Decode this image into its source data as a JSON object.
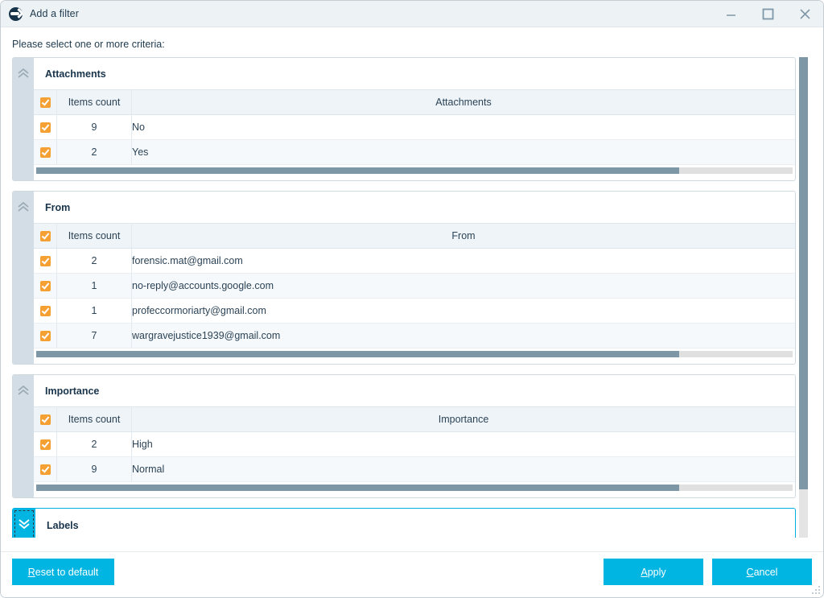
{
  "window": {
    "title": "Add a filter",
    "icon": "app-logo-icon",
    "controls": {
      "minimize": "minimize-icon",
      "maximize": "maximize-icon",
      "close": "close-icon"
    }
  },
  "prompt": "Please select one or more criteria:",
  "columns": {
    "count": "Items count"
  },
  "sections": [
    {
      "title": "Attachments",
      "collapsed": false,
      "value_header": "Attachments",
      "header_checked": true,
      "hscroll_percent": 85,
      "rows": [
        {
          "checked": true,
          "count": "9",
          "value": "No"
        },
        {
          "checked": true,
          "count": "2",
          "value": "Yes"
        }
      ]
    },
    {
      "title": "From",
      "collapsed": false,
      "value_header": "From",
      "header_checked": true,
      "hscroll_percent": 85,
      "rows": [
        {
          "checked": true,
          "count": "2",
          "value": "forensic.mat@gmail.com"
        },
        {
          "checked": true,
          "count": "1",
          "value": "no-reply@accounts.google.com"
        },
        {
          "checked": true,
          "count": "1",
          "value": "profeccormoriarty@gmail.com"
        },
        {
          "checked": true,
          "count": "7",
          "value": "wargravejustice1939@gmail.com"
        }
      ]
    },
    {
      "title": "Importance",
      "collapsed": false,
      "value_header": "Importance",
      "header_checked": true,
      "hscroll_percent": 85,
      "rows": [
        {
          "checked": true,
          "count": "2",
          "value": "High"
        },
        {
          "checked": true,
          "count": "9",
          "value": "Normal"
        }
      ]
    },
    {
      "title": "Labels",
      "collapsed": true,
      "value_header": "",
      "header_checked": false,
      "hscroll_percent": 0,
      "rows": []
    }
  ],
  "scrollbar": {
    "vertical_thumb_percent": 90
  },
  "footer": {
    "reset": {
      "pre": "",
      "mnemonic": "R",
      "post": "eset to default"
    },
    "apply": {
      "pre": "",
      "mnemonic": "A",
      "post": "pply"
    },
    "cancel": {
      "pre": "",
      "mnemonic": "C",
      "post": "ancel"
    }
  },
  "colors": {
    "accent": "#00b5e2",
    "checkbox": "#f5a033",
    "titlebar": "#edf2f5",
    "strip": "#d2dde6",
    "scroll_thumb": "#7d97a6"
  }
}
